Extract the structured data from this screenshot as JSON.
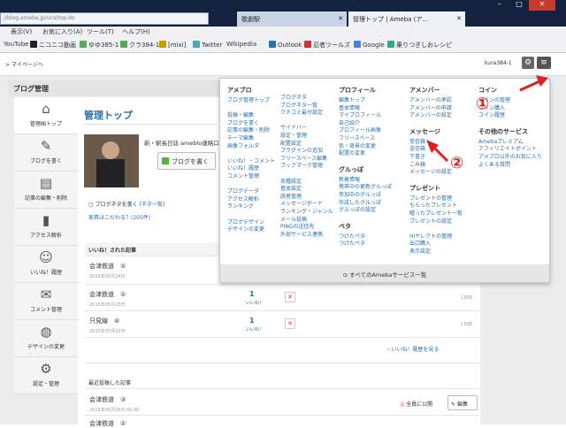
{
  "browser": {
    "url": "//blog.ameba.jp/ucs/top.do",
    "tabs": [
      {
        "label": "歌劇駅"
      },
      {
        "label": "管理トップ | Ameba (ア..."
      }
    ],
    "menu": [
      "表示(V)",
      "お気に入り(A)",
      "ツール(T)",
      "ヘルプ(H)"
    ],
    "bookmarks": [
      "YouTube",
      "ニコニコ動画",
      "ゆゆ385-1",
      "クラ384-1",
      "[mixi]",
      "Twitter",
      "Wikipedia",
      "Outlook",
      "忍者ツールズ",
      "Google",
      "乗りつぎしおレシピ"
    ]
  },
  "header": {
    "breadcrumb": "> マイページへ",
    "user": "kura384-1"
  },
  "section_title": "ブログ管理",
  "sidebar": [
    {
      "label": "管理画トップ",
      "icon": "home-icon"
    },
    {
      "label": "ブログを書く",
      "icon": "pencil-icon"
    },
    {
      "label": "記事の編集・削除",
      "icon": "document-icon"
    },
    {
      "label": "アクセス解析",
      "icon": "chart-icon"
    },
    {
      "label": "いいね！履歴",
      "icon": "smiley-icon"
    },
    {
      "label": "コメント管理",
      "icon": "comment-icon"
    },
    {
      "label": "デザインの変更",
      "icon": "palette-icon"
    },
    {
      "label": "設定・管理",
      "icon": "gear-icon"
    }
  ],
  "main": {
    "title": "管理トップ",
    "blog_name": "新・駅長日誌 ameblo連絡口",
    "write_button": "ブログを書く",
    "neta_label": "ブログネタを書く",
    "neta_link": "[ネタ一覧]",
    "neta_question": "家具はこだわる？(205件)",
    "liked_header": "いいね！された記事",
    "liked_articles": [
      {
        "title": "会津鉄道",
        "num": "②",
        "date": "2015年05月24日",
        "count": "1",
        "unit": "いいね！",
        "time": "1日前"
      },
      {
        "title": "会津鉄道",
        "num": "①",
        "date": "2015年05月23日",
        "count": "1",
        "unit": "いいね！",
        "time": "1日前"
      },
      {
        "title": "只見線",
        "num": "④",
        "date": "2015年05月22日",
        "count": "1",
        "unit": "いいね！",
        "time": "1日前"
      }
    ],
    "liked_history_link": "いいね！履歴を見る",
    "recent_header": "最近投稿した記事",
    "recent_articles": [
      {
        "title": "会津鉄道",
        "num": "③",
        "date": "2015年05月25日 00:00",
        "visibility": "全員に公開",
        "edit": "編集"
      },
      {
        "title": "会津鉄道",
        "num": "②",
        "date": "",
        "visibility": "",
        "edit": ""
      }
    ]
  },
  "dropdown": {
    "col1": [
      {
        "header": "アメブロ",
        "links": [
          "ブログ管理トップ",
          "",
          "投稿・編集",
          "ブログを書く",
          "記事の編集・削除",
          "テーマ編集",
          "画像フォルダ",
          "",
          "いいね！・コメント",
          "いいね！履歴",
          "コメント管理",
          "",
          "プログデータ",
          "アクセス解析",
          "ランキング",
          "",
          "プログデザイン",
          "デザインの変更"
        ]
      }
    ],
    "col2": [
      {
        "header": "",
        "links": [
          "ブログネタ",
          "ブログネタ一覧",
          "クチコミ最付設定",
          "",
          "サイドバー",
          "設定・管理",
          "配置設定",
          "プラグインの追加",
          "フリースペース編集",
          "ブックマーク管理",
          "",
          "各種設定",
          "基本設定",
          "読者管理",
          "メッセージボード",
          "ランキング・ジャンル",
          "メール投稿",
          "PINGの送信先",
          "外部サービス連携"
        ]
      }
    ],
    "col3": [
      {
        "header": "プロフィール",
        "links": [
          "編集トップ",
          "基本情報",
          "マイプロフィール",
          "自己紹介",
          "プロフィール画像",
          "フリースペース",
          "色・背景の変更",
          "配置の変更"
        ]
      },
      {
        "header": "グルっぽ",
        "links": [
          "新着情報",
          "携帯中の更新グルっぽ",
          "参加中のグルっぽ",
          "作成したグルっぽ",
          "グルっぽの設定"
        ]
      },
      {
        "header": "ペタ",
        "links": [
          "つけたペタ",
          "つけたペタ"
        ]
      }
    ],
    "col4": [
      {
        "header": "アメンバー",
        "links": [
          "アメンバーの承認",
          "アメンバーの申請",
          "アメンバーの設定"
        ]
      },
      {
        "header": "メッセージ",
        "links": [
          "受信箱",
          "送信箱",
          "下書き",
          "ごみ箱",
          "メッセージの設定"
        ]
      },
      {
        "header": "プレゼント",
        "links": [
          "プレゼントの管理",
          "もらったプレゼント",
          "贈ったプレゼント一覧",
          "プレゼントの設定",
          "",
          "Hiヤレクトの管理",
          "出口購入",
          "表示設定"
        ]
      }
    ],
    "col5": [
      {
        "header": "コイン",
        "links": [
          "コインの管理",
          "コイン購入",
          "コイン履歴"
        ]
      },
      {
        "header": "その他のサービス",
        "links": [
          "Amebaプレミアム",
          "アフィリエイトポイント",
          "アメブロ以外のお気に入り",
          "よくある質問"
        ]
      }
    ],
    "footer": "すべてのAmebaサービス一覧"
  },
  "annotations": {
    "one": "①",
    "two": "②"
  },
  "colors": {
    "accent": "#2a6fa8",
    "annotation": "#e02020",
    "write_button_icon": "#5aae3a"
  }
}
